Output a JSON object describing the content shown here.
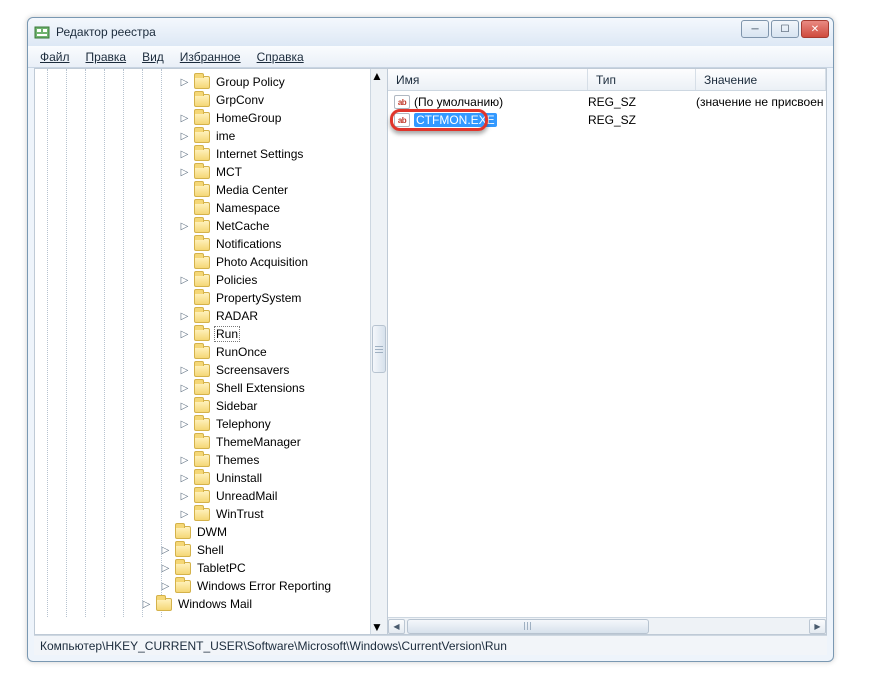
{
  "window": {
    "title": "Редактор реестра"
  },
  "menu": {
    "file": "Файл",
    "edit": "Правка",
    "view": "Вид",
    "favorites": "Избранное",
    "help": "Справка"
  },
  "tree": {
    "items": [
      {
        "label": "Group Policy",
        "indent": 144,
        "expandable": true
      },
      {
        "label": "GrpConv",
        "indent": 144,
        "expandable": false
      },
      {
        "label": "HomeGroup",
        "indent": 144,
        "expandable": true
      },
      {
        "label": "ime",
        "indent": 144,
        "expandable": true
      },
      {
        "label": "Internet Settings",
        "indent": 144,
        "expandable": true
      },
      {
        "label": "MCT",
        "indent": 144,
        "expandable": true
      },
      {
        "label": "Media Center",
        "indent": 144,
        "expandable": false
      },
      {
        "label": "Namespace",
        "indent": 144,
        "expandable": false
      },
      {
        "label": "NetCache",
        "indent": 144,
        "expandable": true
      },
      {
        "label": "Notifications",
        "indent": 144,
        "expandable": false
      },
      {
        "label": "Photo Acquisition",
        "indent": 144,
        "expandable": false
      },
      {
        "label": "Policies",
        "indent": 144,
        "expandable": true
      },
      {
        "label": "PropertySystem",
        "indent": 144,
        "expandable": false
      },
      {
        "label": "RADAR",
        "indent": 144,
        "expandable": true
      },
      {
        "label": "Run",
        "indent": 144,
        "expandable": true,
        "selected": true
      },
      {
        "label": "RunOnce",
        "indent": 144,
        "expandable": false
      },
      {
        "label": "Screensavers",
        "indent": 144,
        "expandable": true
      },
      {
        "label": "Shell Extensions",
        "indent": 144,
        "expandable": true
      },
      {
        "label": "Sidebar",
        "indent": 144,
        "expandable": true
      },
      {
        "label": "Telephony",
        "indent": 144,
        "expandable": true
      },
      {
        "label": "ThemeManager",
        "indent": 144,
        "expandable": false
      },
      {
        "label": "Themes",
        "indent": 144,
        "expandable": true
      },
      {
        "label": "Uninstall",
        "indent": 144,
        "expandable": true
      },
      {
        "label": "UnreadMail",
        "indent": 144,
        "expandable": true
      },
      {
        "label": "WinTrust",
        "indent": 144,
        "expandable": true
      },
      {
        "label": "DWM",
        "indent": 125,
        "expandable": false
      },
      {
        "label": "Shell",
        "indent": 125,
        "expandable": true
      },
      {
        "label": "TabletPC",
        "indent": 125,
        "expandable": true
      },
      {
        "label": "Windows Error Reporting",
        "indent": 125,
        "expandable": true
      },
      {
        "label": "Windows Mail",
        "indent": 106,
        "expandable": true
      }
    ]
  },
  "columns": {
    "name": "Имя",
    "type": "Тип",
    "value": "Значение"
  },
  "rows": [
    {
      "name": "(По умолчанию)",
      "type": "REG_SZ",
      "value": "(значение не присвоен",
      "highlighted": false
    },
    {
      "name": "CTFMON.EXE",
      "type": "REG_SZ",
      "value": "",
      "highlighted": true
    }
  ],
  "statusbar": {
    "path": "Компьютер\\HKEY_CURRENT_USER\\Software\\Microsoft\\Windows\\CurrentVersion\\Run"
  },
  "icons": {
    "reg_sz": "ab"
  }
}
